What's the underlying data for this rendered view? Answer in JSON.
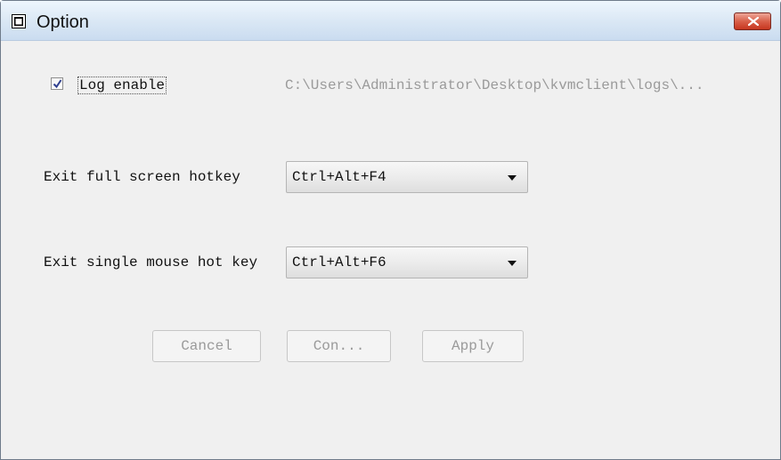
{
  "window": {
    "title": "Option"
  },
  "log": {
    "checked": true,
    "label": "Log enable",
    "path": "C:\\Users\\Administrator\\Desktop\\kvmclient\\logs\\..."
  },
  "hotkeys": {
    "full_screen": {
      "label": "Exit full screen hotkey",
      "value": "Ctrl+Alt+F4"
    },
    "single_mouse": {
      "label": "Exit single mouse hot key",
      "value": "Ctrl+Alt+F6"
    }
  },
  "buttons": {
    "cancel": "Cancel",
    "confirm": "Con...",
    "apply": "Apply"
  },
  "colors": {
    "close_button": "#c6361f",
    "disabled_text": "#9a9a9a"
  }
}
